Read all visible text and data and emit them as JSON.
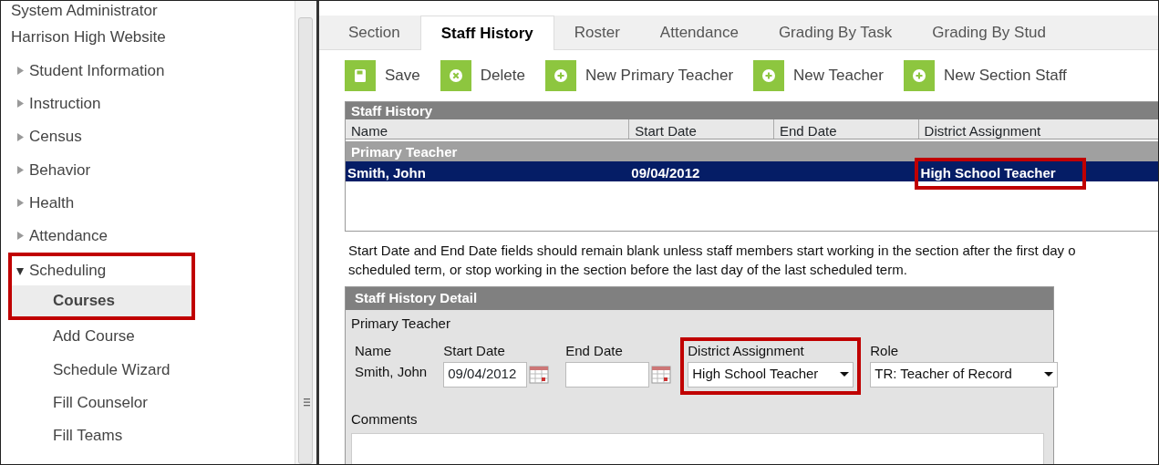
{
  "sidebar": {
    "items": [
      {
        "label": "System Administrator",
        "kind": "link"
      },
      {
        "label": "Harrison High Website",
        "kind": "link"
      },
      {
        "label": "Student Information",
        "kind": "folder",
        "expanded": false
      },
      {
        "label": "Instruction",
        "kind": "folder",
        "expanded": false
      },
      {
        "label": "Census",
        "kind": "folder",
        "expanded": false
      },
      {
        "label": "Behavior",
        "kind": "folder",
        "expanded": false
      },
      {
        "label": "Health",
        "kind": "folder",
        "expanded": false
      },
      {
        "label": "Attendance",
        "kind": "folder",
        "expanded": false
      },
      {
        "label": "Scheduling",
        "kind": "folder",
        "expanded": true,
        "highlighted": true,
        "children": [
          {
            "label": "Courses",
            "selected": true
          },
          {
            "label": "Add Course",
            "selected": false
          },
          {
            "label": "Schedule Wizard",
            "selected": false
          },
          {
            "label": "Fill Counselor",
            "selected": false
          },
          {
            "label": "Fill Teams",
            "selected": false
          }
        ]
      }
    ]
  },
  "tabs": [
    {
      "label": "Section",
      "selected": false
    },
    {
      "label": "Staff History",
      "selected": true
    },
    {
      "label": "Roster",
      "selected": false
    },
    {
      "label": "Attendance",
      "selected": false
    },
    {
      "label": "Grading By Task",
      "selected": false
    },
    {
      "label": "Grading By Stud",
      "selected": false
    }
  ],
  "toolbar": [
    {
      "label": "Save",
      "kind": "save"
    },
    {
      "label": "Delete",
      "kind": "delete"
    },
    {
      "label": "New Primary Teacher",
      "kind": "add"
    },
    {
      "label": "New Teacher",
      "kind": "add"
    },
    {
      "label": "New Section Staff",
      "kind": "add"
    }
  ],
  "grid": {
    "title": "Staff History",
    "columns": [
      "Name",
      "Start Date",
      "End Date",
      "District Assignment"
    ],
    "groups": [
      {
        "label": "Primary Teacher",
        "rows": [
          {
            "selected": true,
            "cells": [
              {
                "text": "Smith, John",
                "highlighted": false
              },
              {
                "text": "09/04/2012",
                "highlighted": false
              },
              {
                "highlighted": false
              },
              {
                "text": "High School Teacher",
                "highlighted": true
              }
            ]
          }
        ]
      }
    ]
  },
  "note_lines": [
    "Start Date and End Date fields should remain blank unless staff members start working in the section after the first day o",
    "scheduled term, or stop working in the section before the last day of the last scheduled term."
  ],
  "detail": {
    "title": "Staff History Detail",
    "subtitle": "Primary Teacher",
    "name_label": "Name",
    "name_value": "Smith, John",
    "fields": [
      {
        "label": "Start Date",
        "value": "09/04/2012",
        "kind": "date",
        "highlighted": false
      },
      {
        "label": "End Date",
        "kind": "date",
        "highlighted": false
      },
      {
        "label": "District Assignment",
        "value": "High School Teacher",
        "kind": "select",
        "highlighted": true
      },
      {
        "label": "Role",
        "value": "TR: Teacher of Record",
        "kind": "select",
        "highlighted": false
      }
    ],
    "comments_label": "Comments"
  }
}
